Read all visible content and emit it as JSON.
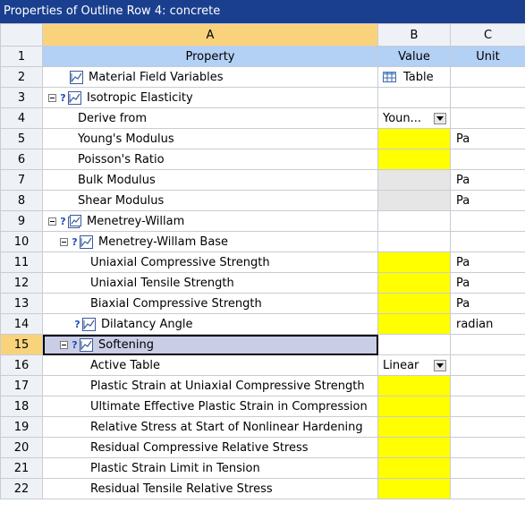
{
  "window": {
    "title": "Properties of Outline Row 4: concrete"
  },
  "columns": [
    "A",
    "B",
    "C"
  ],
  "header": {
    "row": "1",
    "property": "Property",
    "value": "Value",
    "unit": "Unit"
  },
  "rows": [
    {
      "num": "2",
      "label": "Material Field Variables",
      "value": "Table",
      "unit": ""
    },
    {
      "num": "3",
      "label": "Isotropic Elasticity",
      "value": "",
      "unit": ""
    },
    {
      "num": "4",
      "label": "Derive from",
      "value": "Youn...",
      "unit": ""
    },
    {
      "num": "5",
      "label": "Young's Modulus",
      "value": "",
      "unit": "Pa"
    },
    {
      "num": "6",
      "label": "Poisson's Ratio",
      "value": "",
      "unit": ""
    },
    {
      "num": "7",
      "label": "Bulk Modulus",
      "value": "",
      "unit": "Pa"
    },
    {
      "num": "8",
      "label": "Shear Modulus",
      "value": "",
      "unit": "Pa"
    },
    {
      "num": "9",
      "label": "Menetrey-Willam",
      "value": "",
      "unit": ""
    },
    {
      "num": "10",
      "label": "Menetrey-Willam Base",
      "value": "",
      "unit": ""
    },
    {
      "num": "11",
      "label": "Uniaxial Compressive Strength",
      "value": "",
      "unit": "Pa"
    },
    {
      "num": "12",
      "label": "Uniaxial Tensile Strength",
      "value": "",
      "unit": "Pa"
    },
    {
      "num": "13",
      "label": "Biaxial Compressive Strength",
      "value": "",
      "unit": "Pa"
    },
    {
      "num": "14",
      "label": "Dilatancy Angle",
      "value": "",
      "unit": "radian"
    },
    {
      "num": "15",
      "label": "Softening",
      "value": "",
      "unit": ""
    },
    {
      "num": "16",
      "label": "Active Table",
      "value": "Linear",
      "unit": ""
    },
    {
      "num": "17",
      "label": "Plastic Strain at Uniaxial Compressive Strength",
      "value": "",
      "unit": ""
    },
    {
      "num": "18",
      "label": "Ultimate Effective Plastic Strain in Compression",
      "value": "",
      "unit": ""
    },
    {
      "num": "19",
      "label": "Relative Stress at Start of Nonlinear Hardening",
      "value": "",
      "unit": ""
    },
    {
      "num": "20",
      "label": "Residual Compressive Relative Stress",
      "value": "",
      "unit": ""
    },
    {
      "num": "21",
      "label": "Plastic Strain Limit in Tension",
      "value": "",
      "unit": ""
    },
    {
      "num": "22",
      "label": "Residual Tensile Relative Stress",
      "value": "",
      "unit": ""
    }
  ],
  "colors": {
    "title_bar": "#1a3f8f",
    "required_input": "#ffff00",
    "selected_row": "#c9cde6",
    "column_header_active": "#f9d37c"
  },
  "icons": {
    "property": "property-chart-icon",
    "group": "property-group-icon",
    "table": "table-icon",
    "expand": "collapse-minus-icon",
    "dropdown": "dropdown-arrow-icon"
  }
}
